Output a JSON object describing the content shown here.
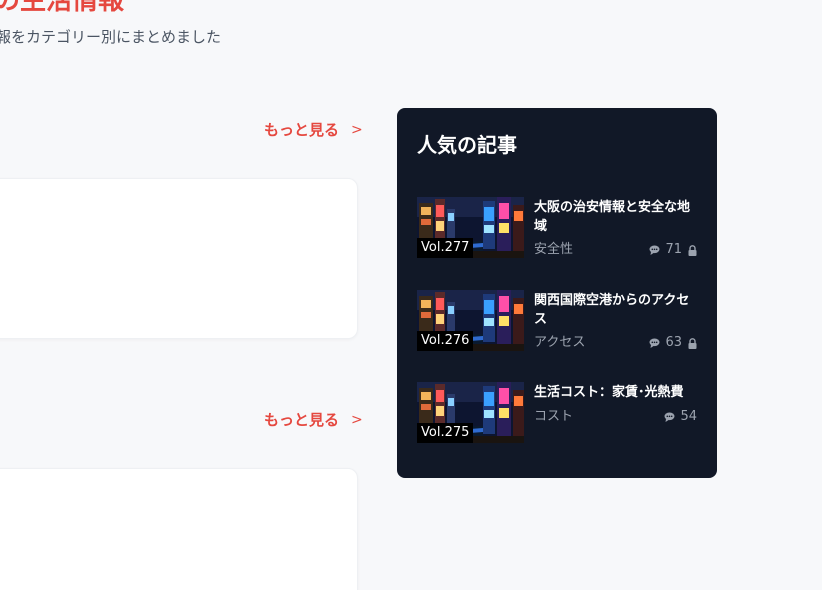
{
  "hero": {
    "title": "の生活情報",
    "subtitle": "報をカテゴリー別にまとめました"
  },
  "sections": [
    {
      "more_label": "もっと見る",
      "more_chevron": ">"
    },
    {
      "more_label": "もっと見る",
      "more_chevron": ">"
    }
  ],
  "sidebar": {
    "title": "人気の記事",
    "articles": [
      {
        "vol": "Vol.277",
        "title": "大阪の治安情報と安全な地域",
        "category": "安全性",
        "comments": "71",
        "locked": true
      },
      {
        "vol": "Vol.276",
        "title": "関西国際空港からのアクセス",
        "category": "アクセス",
        "comments": "63",
        "locked": true
      },
      {
        "vol": "Vol.275",
        "title": "生活コスト：家賃･光熱費",
        "category": "コスト",
        "comments": "54",
        "locked": false
      }
    ]
  },
  "colors": {
    "accent": "#e5483f",
    "sidebar_bg": "#111827",
    "page_bg": "#f7f8fa",
    "muted_text": "#9ca3af"
  },
  "icons": {
    "comment": "chat-bubble-icon",
    "lock": "lock-icon",
    "chevron": "chevron-right-icon"
  }
}
